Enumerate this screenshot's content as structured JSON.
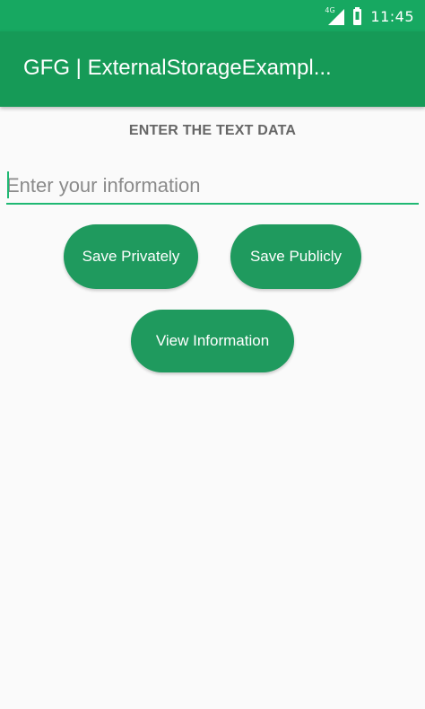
{
  "status_bar": {
    "network_type": "4G",
    "time": "11:45",
    "icons": [
      "signal-icon",
      "battery-icon"
    ]
  },
  "app_bar": {
    "title": "GFG | ExternalStorageExampl..."
  },
  "main": {
    "section_label": "ENTER THE TEXT DATA",
    "input": {
      "placeholder": "Enter your information",
      "value": ""
    },
    "buttons": {
      "save_privately": "Save Privately",
      "save_publicly": "Save Publicly",
      "view_information": "View Information"
    }
  },
  "colors": {
    "status_bar": "#17a861",
    "app_bar": "#169a57",
    "button": "#1f9a5e",
    "accent": "#1fb873"
  }
}
